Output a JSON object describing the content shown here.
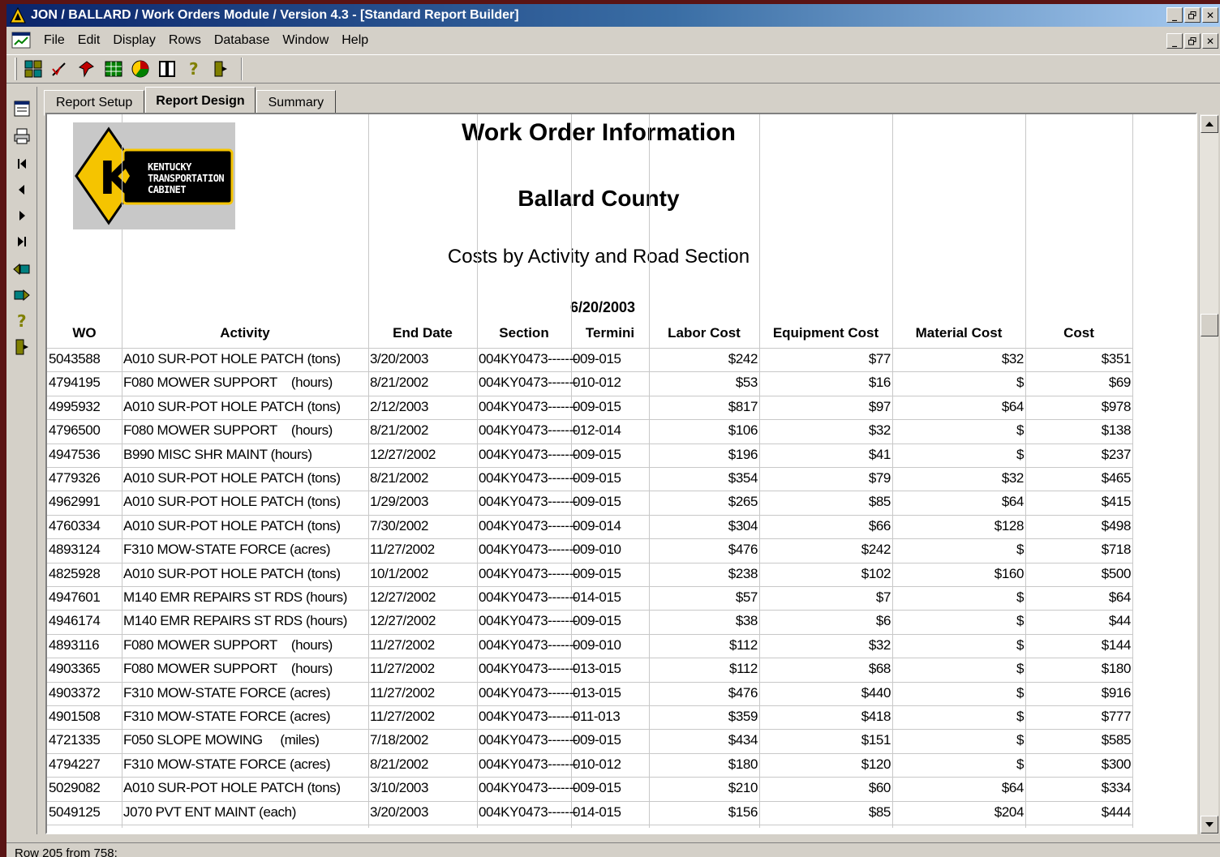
{
  "title_bar": {
    "title": "JON / BALLARD / Work Orders Module / Version 4.3 - [Standard Report Builder]"
  },
  "window_controls": {
    "minimize": "_",
    "restore": "🗗",
    "close": "✕"
  },
  "menu": [
    "File",
    "Edit",
    "Display",
    "Rows",
    "Database",
    "Window",
    "Help"
  ],
  "toolbar": [
    "grid-icon",
    "edit-icon",
    "pin-icon",
    "table-icon",
    "chart-icon",
    "columns-icon",
    "help-icon",
    "exit-icon"
  ],
  "side_toolbar": [
    "report-icon",
    "print-icon",
    "first-icon",
    "prev-icon",
    "next-icon",
    "last-icon",
    "back-icon",
    "forward-icon",
    "help-icon",
    "exit-icon"
  ],
  "tabs": [
    {
      "label": "Report Setup",
      "active": false
    },
    {
      "label": "Report Design",
      "active": true
    },
    {
      "label": "Summary",
      "active": false
    }
  ],
  "report": {
    "logo": {
      "letter": "K",
      "text_lines": [
        "KENTUCKY",
        "TRANSPORTATION",
        "CABINET"
      ]
    },
    "title": "Work Order Information",
    "county": "Ballard County",
    "subtitle": "Costs by Activity and Road Section",
    "date": "6/20/2003",
    "columns": [
      "WO",
      "Activity",
      "End Date",
      "Section",
      "Termini",
      "Labor Cost",
      "Equipment Cost",
      "Material Cost",
      "Cost"
    ],
    "rows": [
      [
        "5043588",
        "A010 SUR-POT HOLE PATCH (tons)",
        "3/20/2003",
        "004KY0473-------",
        "009-015",
        "$242",
        "$77",
        "$32",
        "$351"
      ],
      [
        "4794195",
        "F080 MOWER SUPPORT    (hours)",
        "8/21/2002",
        "004KY0473-------",
        "010-012",
        "$53",
        "$16",
        "$",
        "$69"
      ],
      [
        "4995932",
        "A010 SUR-POT HOLE PATCH (tons)",
        "2/12/2003",
        "004KY0473-------",
        "009-015",
        "$817",
        "$97",
        "$64",
        "$978"
      ],
      [
        "4796500",
        "F080 MOWER SUPPORT    (hours)",
        "8/21/2002",
        "004KY0473-------",
        "012-014",
        "$106",
        "$32",
        "$",
        "$138"
      ],
      [
        "4947536",
        "B990 MISC SHR MAINT (hours)",
        "12/27/2002",
        "004KY0473-------",
        "009-015",
        "$196",
        "$41",
        "$",
        "$237"
      ],
      [
        "4779326",
        "A010 SUR-POT HOLE PATCH (tons)",
        "8/21/2002",
        "004KY0473-------",
        "009-015",
        "$354",
        "$79",
        "$32",
        "$465"
      ],
      [
        "4962991",
        "A010 SUR-POT HOLE PATCH (tons)",
        "1/29/2003",
        "004KY0473-------",
        "009-015",
        "$265",
        "$85",
        "$64",
        "$415"
      ],
      [
        "4760334",
        "A010 SUR-POT HOLE PATCH (tons)",
        "7/30/2002",
        "004KY0473-------",
        "009-014",
        "$304",
        "$66",
        "$128",
        "$498"
      ],
      [
        "4893124",
        "F310 MOW-STATE FORCE (acres)",
        "11/27/2002",
        "004KY0473-------",
        "009-010",
        "$476",
        "$242",
        "$",
        "$718"
      ],
      [
        "4825928",
        "A010 SUR-POT HOLE PATCH (tons)",
        "10/1/2002",
        "004KY0473-------",
        "009-015",
        "$238",
        "$102",
        "$160",
        "$500"
      ],
      [
        "4947601",
        "M140 EMR REPAIRS ST RDS (hours)",
        "12/27/2002",
        "004KY0473-------",
        "014-015",
        "$57",
        "$7",
        "$",
        "$64"
      ],
      [
        "4946174",
        "M140 EMR REPAIRS ST RDS (hours)",
        "12/27/2002",
        "004KY0473-------",
        "009-015",
        "$38",
        "$6",
        "$",
        "$44"
      ],
      [
        "4893116",
        "F080 MOWER SUPPORT    (hours)",
        "11/27/2002",
        "004KY0473-------",
        "009-010",
        "$112",
        "$32",
        "$",
        "$144"
      ],
      [
        "4903365",
        "F080 MOWER SUPPORT    (hours)",
        "11/27/2002",
        "004KY0473-------",
        "013-015",
        "$112",
        "$68",
        "$",
        "$180"
      ],
      [
        "4903372",
        "F310 MOW-STATE FORCE (acres)",
        "11/27/2002",
        "004KY0473-------",
        "013-015",
        "$476",
        "$440",
        "$",
        "$916"
      ],
      [
        "4901508",
        "F310 MOW-STATE FORCE (acres)",
        "11/27/2002",
        "004KY0473-------",
        "011-013",
        "$359",
        "$418",
        "$",
        "$777"
      ],
      [
        "4721335",
        "F050 SLOPE MOWING     (miles)",
        "7/18/2002",
        "004KY0473-------",
        "009-015",
        "$434",
        "$151",
        "$",
        "$585"
      ],
      [
        "4794227",
        "F310 MOW-STATE FORCE (acres)",
        "8/21/2002",
        "004KY0473-------",
        "010-012",
        "$180",
        "$120",
        "$",
        "$300"
      ],
      [
        "5029082",
        "A010 SUR-POT HOLE PATCH (tons)",
        "3/10/2003",
        "004KY0473-------",
        "009-015",
        "$210",
        "$60",
        "$64",
        "$334"
      ],
      [
        "5049125",
        "J070 PVT ENT MAINT (each)",
        "3/20/2003",
        "004KY0473-------",
        "014-015",
        "$156",
        "$85",
        "$204",
        "$444"
      ]
    ]
  },
  "status": {
    "text": "Row 205 from 758;"
  },
  "colors": {
    "title_bar": "#0a246a",
    "chrome": "#d4d0c8",
    "background": "#5a1414",
    "logo_yellow": "#f5c400"
  }
}
